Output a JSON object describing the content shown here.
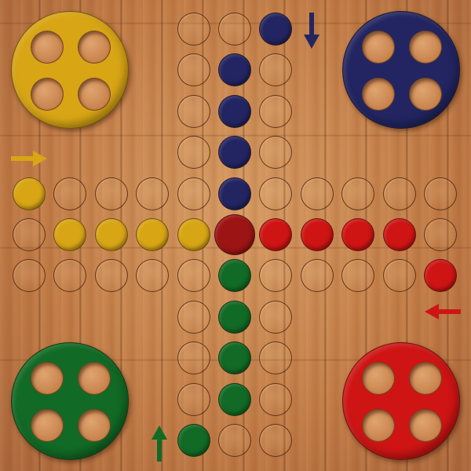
{
  "colors": {
    "yellow": "#d8a515",
    "blue": "#222561",
    "red": "#cf1414",
    "green": "#116a25",
    "board_wood": "#c78450"
  },
  "homes": [
    {
      "color": "yellow",
      "name": "home-yellow"
    },
    {
      "color": "blue",
      "name": "home-blue"
    },
    {
      "color": "green",
      "name": "home-green"
    },
    {
      "color": "red",
      "name": "home-red"
    }
  ],
  "arrows": [
    {
      "color": "blue",
      "direction": "down",
      "name": "blue-start-arrow-icon"
    },
    {
      "color": "yellow",
      "direction": "right",
      "name": "yellow-start-arrow-icon"
    },
    {
      "color": "red",
      "direction": "left",
      "name": "red-start-arrow-icon"
    },
    {
      "color": "green",
      "direction": "up",
      "name": "green-start-arrow-icon"
    }
  ],
  "track": [
    {
      "col": 4,
      "row": 0,
      "fill": ""
    },
    {
      "col": 5,
      "row": 0,
      "fill": ""
    },
    {
      "col": 6,
      "row": 0,
      "fill": "blue"
    },
    {
      "col": 4,
      "row": 1,
      "fill": ""
    },
    {
      "col": 5,
      "row": 1,
      "fill": "blue"
    },
    {
      "col": 6,
      "row": 1,
      "fill": ""
    },
    {
      "col": 4,
      "row": 2,
      "fill": ""
    },
    {
      "col": 5,
      "row": 2,
      "fill": "blue"
    },
    {
      "col": 6,
      "row": 2,
      "fill": ""
    },
    {
      "col": 4,
      "row": 3,
      "fill": ""
    },
    {
      "col": 5,
      "row": 3,
      "fill": "blue"
    },
    {
      "col": 6,
      "row": 3,
      "fill": ""
    },
    {
      "col": 0,
      "row": 4,
      "fill": "yellow"
    },
    {
      "col": 1,
      "row": 4,
      "fill": ""
    },
    {
      "col": 2,
      "row": 4,
      "fill": ""
    },
    {
      "col": 3,
      "row": 4,
      "fill": ""
    },
    {
      "col": 4,
      "row": 4,
      "fill": ""
    },
    {
      "col": 5,
      "row": 4,
      "fill": "blue"
    },
    {
      "col": 6,
      "row": 4,
      "fill": ""
    },
    {
      "col": 7,
      "row": 4,
      "fill": ""
    },
    {
      "col": 8,
      "row": 4,
      "fill": ""
    },
    {
      "col": 9,
      "row": 4,
      "fill": ""
    },
    {
      "col": 10,
      "row": 4,
      "fill": ""
    },
    {
      "col": 0,
      "row": 5,
      "fill": ""
    },
    {
      "col": 1,
      "row": 5,
      "fill": "yellow"
    },
    {
      "col": 2,
      "row": 5,
      "fill": "yellow"
    },
    {
      "col": 3,
      "row": 5,
      "fill": "yellow"
    },
    {
      "col": 4,
      "row": 5,
      "fill": "yellow"
    },
    {
      "col": 5,
      "row": 5,
      "fill": "darkred",
      "big": true
    },
    {
      "col": 6,
      "row": 5,
      "fill": "red"
    },
    {
      "col": 7,
      "row": 5,
      "fill": "red"
    },
    {
      "col": 8,
      "row": 5,
      "fill": "red"
    },
    {
      "col": 9,
      "row": 5,
      "fill": "red"
    },
    {
      "col": 10,
      "row": 5,
      "fill": ""
    },
    {
      "col": 0,
      "row": 6,
      "fill": ""
    },
    {
      "col": 1,
      "row": 6,
      "fill": ""
    },
    {
      "col": 2,
      "row": 6,
      "fill": ""
    },
    {
      "col": 3,
      "row": 6,
      "fill": ""
    },
    {
      "col": 4,
      "row": 6,
      "fill": ""
    },
    {
      "col": 5,
      "row": 6,
      "fill": "green"
    },
    {
      "col": 6,
      "row": 6,
      "fill": ""
    },
    {
      "col": 7,
      "row": 6,
      "fill": ""
    },
    {
      "col": 8,
      "row": 6,
      "fill": ""
    },
    {
      "col": 9,
      "row": 6,
      "fill": ""
    },
    {
      "col": 10,
      "row": 6,
      "fill": "red"
    },
    {
      "col": 4,
      "row": 7,
      "fill": ""
    },
    {
      "col": 5,
      "row": 7,
      "fill": "green"
    },
    {
      "col": 6,
      "row": 7,
      "fill": ""
    },
    {
      "col": 4,
      "row": 8,
      "fill": ""
    },
    {
      "col": 5,
      "row": 8,
      "fill": "green"
    },
    {
      "col": 6,
      "row": 8,
      "fill": ""
    },
    {
      "col": 4,
      "row": 9,
      "fill": ""
    },
    {
      "col": 5,
      "row": 9,
      "fill": "green"
    },
    {
      "col": 6,
      "row": 9,
      "fill": ""
    },
    {
      "col": 4,
      "row": 10,
      "fill": "green"
    },
    {
      "col": 5,
      "row": 10,
      "fill": ""
    },
    {
      "col": 6,
      "row": 10,
      "fill": ""
    }
  ]
}
